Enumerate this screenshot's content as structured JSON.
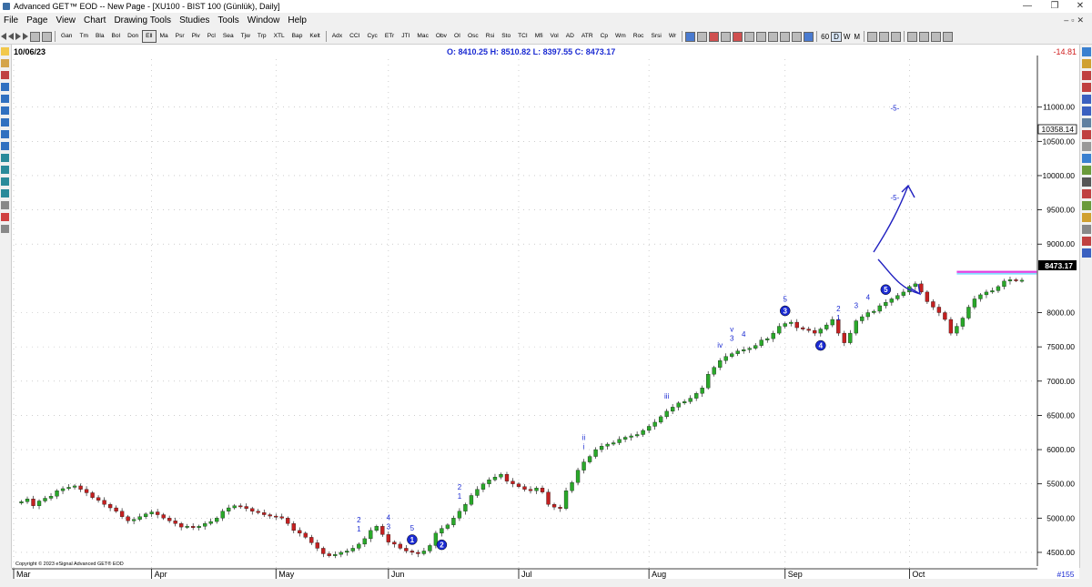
{
  "window": {
    "title": "Advanced GET™ EOD  -- New Page - [XU100 - BIST 100 (Günlük), Daily]",
    "controls": [
      "—",
      "❐",
      "✕"
    ]
  },
  "menu": [
    "File",
    "Page",
    "View",
    "Chart",
    "Drawing Tools",
    "Studies",
    "Tools",
    "Window",
    "Help"
  ],
  "toolbar": {
    "group1": [
      "Gan",
      "Tm",
      "Bla",
      "Bol",
      "Don",
      "Ell",
      "Ma",
      "Psr",
      "Piv",
      "Pcl",
      "Sea",
      "Tjw",
      "Trp",
      "XTL",
      "Bap",
      "Kelt"
    ],
    "active_item": "Ell",
    "group2": [
      "Adx",
      "CCI",
      "Cyc",
      "ETr",
      "JTI",
      "Mac",
      "Obv",
      "OI",
      "Osc",
      "Rsi",
      "Sto",
      "TCI",
      "Mfi",
      "Vol",
      "AD",
      "ATR",
      "Cp",
      "Wm",
      "Roc",
      "Srsi",
      "Wr"
    ],
    "interval_label": "60",
    "interval_active": "D",
    "intervals": [
      "D",
      "W",
      "M"
    ]
  },
  "chart": {
    "date": "10/06/23",
    "ohlc": {
      "O": "8410.25",
      "H": "8510.82",
      "L": "8397.55",
      "C": "8473.17"
    },
    "change": "-14.81",
    "last_price": "8473.17",
    "ref_price": "10358.14",
    "bar_count": "#155",
    "copyright": "Copyright © 2023 eSignal Advanced GET® EOD",
    "accent_colors": {
      "up": "#2aa82a",
      "down": "#c42020",
      "wave": "#1a2ad2",
      "zone": "#e040e0",
      "zone_line": "#5ad0ff"
    }
  },
  "chart_data": {
    "type": "candlestick",
    "ylim": [
      4300,
      11700
    ],
    "y_ticks": [
      "11000.00",
      "10500.00",
      "10000.00",
      "9500.00",
      "9000.00",
      "8000.00",
      "7500.00",
      "7000.00",
      "6500.00",
      "6000.00",
      "5500.00",
      "5000.00",
      "4500.00"
    ],
    "x_months": [
      "Mar",
      "Apr",
      "May",
      "Jun",
      "Jul",
      "Aug",
      "Sep",
      "Oct"
    ],
    "closes": [
      5240,
      5280,
      5180,
      5250,
      5290,
      5320,
      5400,
      5430,
      5450,
      5470,
      5420,
      5370,
      5300,
      5260,
      5200,
      5150,
      5100,
      5020,
      4960,
      4980,
      5020,
      5060,
      5090,
      5050,
      5000,
      4960,
      4920,
      4870,
      4880,
      4860,
      4880,
      4920,
      4950,
      5000,
      5100,
      5150,
      5180,
      5170,
      5140,
      5100,
      5080,
      5050,
      5030,
      5020,
      5000,
      4920,
      4820,
      4780,
      4720,
      4640,
      4560,
      4480,
      4450,
      4470,
      4500,
      4520,
      4560,
      4620,
      4700,
      4820,
      4880,
      4760,
      4650,
      4620,
      4560,
      4520,
      4500,
      4480,
      4520,
      4600,
      4780,
      4850,
      4900,
      5000,
      5100,
      5200,
      5330,
      5420,
      5500,
      5560,
      5600,
      5640,
      5540,
      5500,
      5460,
      5420,
      5400,
      5440,
      5380,
      5200,
      5160,
      5140,
      5400,
      5520,
      5700,
      5820,
      5900,
      6000,
      6050,
      6080,
      6100,
      6150,
      6180,
      6200,
      6220,
      6280,
      6340,
      6400,
      6480,
      6560,
      6620,
      6680,
      6700,
      6750,
      6820,
      6900,
      7100,
      7200,
      7300,
      7360,
      7400,
      7440,
      7460,
      7480,
      7520,
      7600,
      7620,
      7700,
      7800,
      7840,
      7860,
      7780,
      7760,
      7740,
      7700,
      7760,
      7820,
      7900,
      7700,
      7560,
      7700,
      7880,
      7940,
      8000,
      8020,
      8100,
      8150,
      8200,
      8250,
      8300,
      8380,
      8420,
      8300,
      8160,
      8080,
      8000,
      7900,
      7700,
      7800,
      7920,
      8080,
      8200,
      8260,
      8300,
      8320,
      8380,
      8460,
      8480,
      8470,
      8473
    ],
    "wave_labels": [
      {
        "text": "1",
        "circled": true,
        "i": 66
      },
      {
        "text": "5",
        "circled": false,
        "i": 66
      },
      {
        "text": "3",
        "circled": false,
        "i": 62
      },
      {
        "text": "4",
        "circled": false,
        "i": 62
      },
      {
        "text": "2",
        "circled": true,
        "i": 71
      },
      {
        "text": "1",
        "circled": false,
        "i": 57
      },
      {
        "text": "2",
        "circled": false,
        "i": 57
      },
      {
        "text": "1",
        "circled": false,
        "i": 74
      },
      {
        "text": "2",
        "circled": false,
        "i": 74
      },
      {
        "text": "i",
        "circled": false,
        "i": 95
      },
      {
        "text": "ii",
        "circled": false,
        "i": 95
      },
      {
        "text": "iii",
        "circled": false,
        "i": 109
      },
      {
        "text": "iv",
        "circled": false,
        "i": 118
      },
      {
        "text": "3",
        "circled": false,
        "i": 120
      },
      {
        "text": "v",
        "circled": false,
        "i": 120
      },
      {
        "text": "4",
        "circled": false,
        "i": 122
      },
      {
        "text": "3",
        "circled": true,
        "i": 129
      },
      {
        "text": "5",
        "circled": false,
        "i": 129
      },
      {
        "text": "4",
        "circled": true,
        "i": 135
      },
      {
        "text": "1",
        "circled": false,
        "i": 138
      },
      {
        "text": "2",
        "circled": false,
        "i": 138
      },
      {
        "text": "3",
        "circled": false,
        "i": 141
      },
      {
        "text": "4",
        "circled": false,
        "i": 143
      },
      {
        "text": "5",
        "circled": true,
        "i": 146
      },
      {
        "text": "-5-",
        "circled": false,
        "i": 146,
        "level": 10950
      },
      {
        "text": "-5-",
        "circled": false,
        "i": 146,
        "level": 9640
      }
    ],
    "projection_zone": [
      8580,
      8610
    ]
  }
}
